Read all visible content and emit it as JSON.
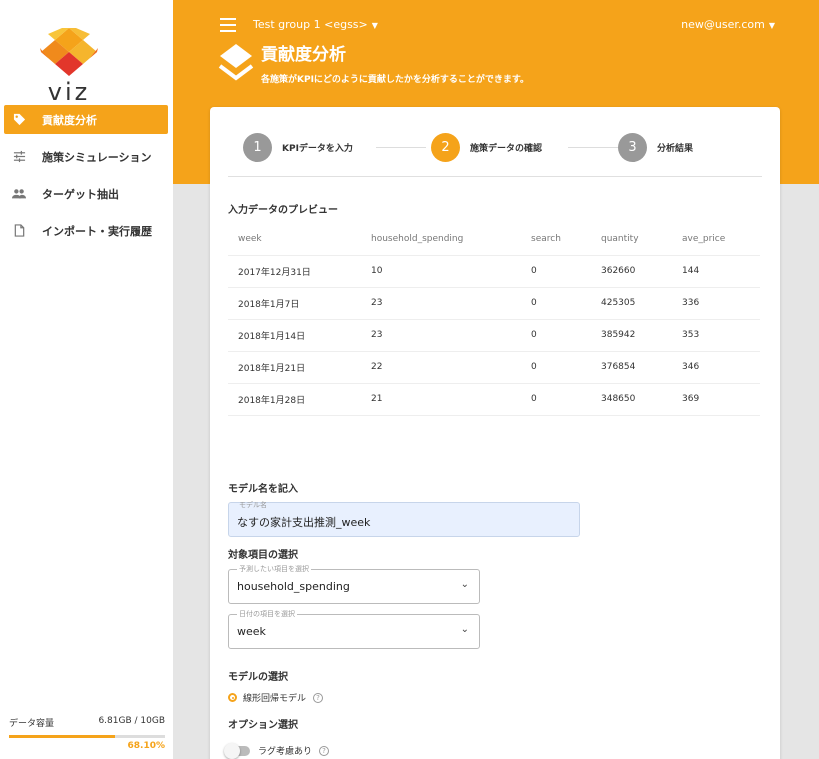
{
  "app": {
    "logo_text": "viz",
    "brand_color": "#f5a31a"
  },
  "sidebar": {
    "items": [
      {
        "label": "貢献度分析",
        "icon": "tag-icon",
        "active": true
      },
      {
        "label": "施策シミュレーション",
        "icon": "sliders-icon",
        "active": false
      },
      {
        "label": "ターゲット抽出",
        "icon": "people-icon",
        "active": false
      },
      {
        "label": "インポート・実行履歴",
        "icon": "file-icon",
        "active": false
      }
    ],
    "storage": {
      "label": "データ容量",
      "usage": "6.81GB / 10GB",
      "percent_label": "68.10%",
      "percent": 68.1
    }
  },
  "header": {
    "group": "Test group 1 <egss>",
    "user": "new@user.com",
    "title": "貢献度分析",
    "subtitle": "各施策がKPIにどのように貢献したかを分析することができます。"
  },
  "stepper": {
    "steps": [
      {
        "num": "1",
        "label": "KPIデータを入力",
        "active": false
      },
      {
        "num": "2",
        "label": "施策データの確認",
        "active": true
      },
      {
        "num": "3",
        "label": "分析結果",
        "active": false
      }
    ]
  },
  "preview": {
    "title": "入力データのプレビュー",
    "columns": [
      "week",
      "household_spending",
      "search",
      "quantity",
      "ave_price"
    ],
    "rows": [
      [
        "2017年12月31日",
        "10",
        "0",
        "362660",
        "144"
      ],
      [
        "2018年1月7日",
        "23",
        "0",
        "425305",
        "336"
      ],
      [
        "2018年1月14日",
        "23",
        "0",
        "385942",
        "353"
      ],
      [
        "2018年1月21日",
        "22",
        "0",
        "376854",
        "346"
      ],
      [
        "2018年1月28日",
        "21",
        "0",
        "348650",
        "369"
      ]
    ]
  },
  "model_name": {
    "section": "モデル名を記入",
    "legend": "モデル名",
    "value": "なすの家計支出推測_week"
  },
  "target": {
    "section": "対象項目の選択",
    "predict": {
      "legend": "予測したい項目を選択",
      "value": "household_spending"
    },
    "date": {
      "legend": "日付の項目を選択",
      "value": "week"
    }
  },
  "model_select": {
    "section": "モデルの選択",
    "option": "線形回帰モデル"
  },
  "options": {
    "section": "オプション選択",
    "lag_label": "ラグ考慮あり"
  },
  "glyphs": {
    "caret": "▼",
    "chevron": "⌄",
    "help": "?"
  }
}
